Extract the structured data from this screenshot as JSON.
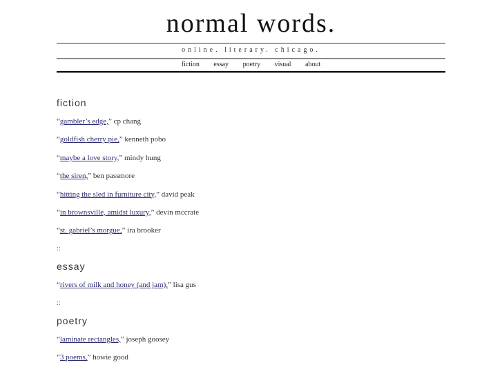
{
  "header": {
    "title": "normal words.",
    "tagline": "online. literary. chicago."
  },
  "nav": {
    "items": [
      {
        "label": "fiction"
      },
      {
        "label": "essay"
      },
      {
        "label": "poetry"
      },
      {
        "label": "visual"
      },
      {
        "label": "about"
      }
    ]
  },
  "separator": "::",
  "sections": [
    {
      "heading": "fiction",
      "entries": [
        {
          "title": "gambler’s edge,",
          "author": " cp chang"
        },
        {
          "title": "goldfish cherry pie,",
          "author": " kenneth pobo"
        },
        {
          "title": "maybe a love story,",
          "author": " mindy hung"
        },
        {
          "title": "the siren,",
          "author": " ben passmore"
        },
        {
          "title": "hitting the sled in furniture city,",
          "author": " david peak"
        },
        {
          "title": "in brownsville, amidst luxury,",
          "author": " devin mccrate"
        },
        {
          "title": "st. gabriel’s morgue,",
          "author": " ira brooker"
        }
      ]
    },
    {
      "heading": "essay",
      "entries": [
        {
          "title": "rivers of milk and honey (and jam),",
          "author": " lisa gus"
        }
      ]
    },
    {
      "heading": "poetry",
      "entries": [
        {
          "title": "laminate rectangles,",
          "author": " joseph goosey"
        },
        {
          "title": "3 poems,",
          "author": " howie good"
        }
      ]
    }
  ],
  "quotes": {
    "open": "“",
    "close": "”"
  },
  "colors": {
    "link": "#2b2b6e",
    "text": "#333333",
    "title": "#111111"
  }
}
